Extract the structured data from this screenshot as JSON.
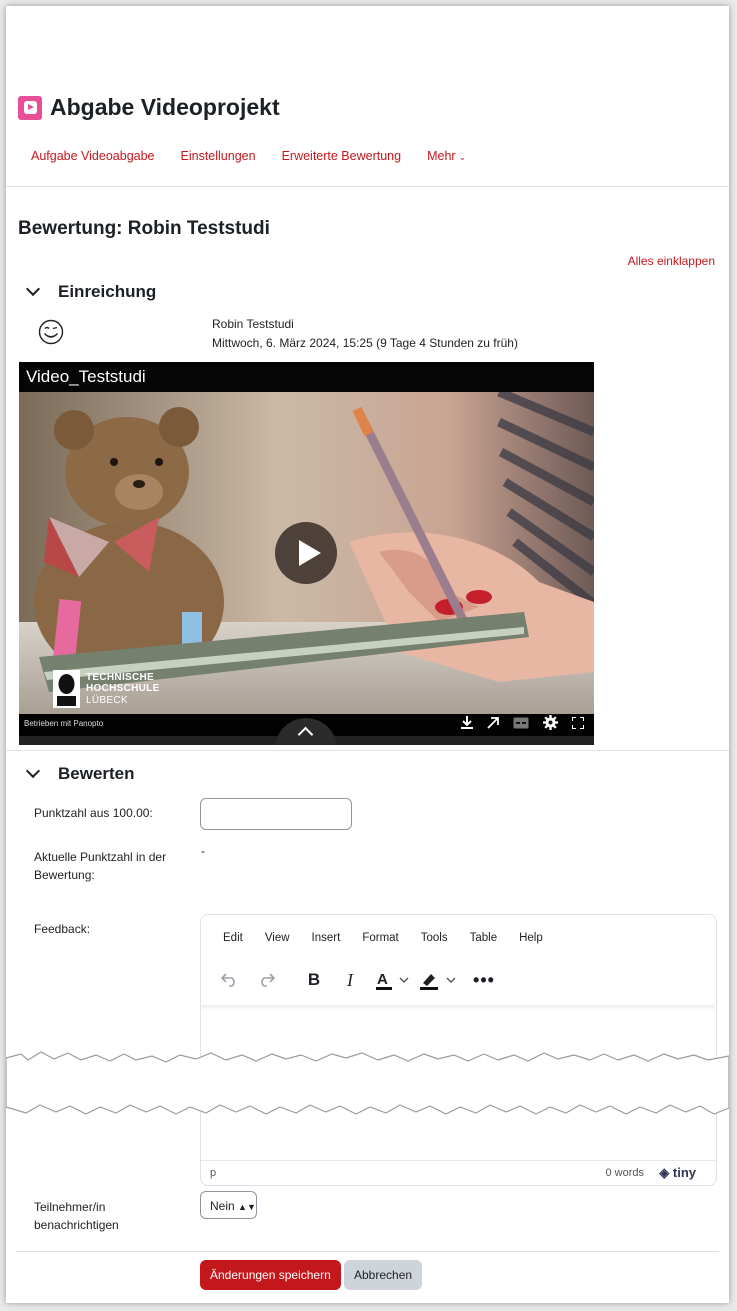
{
  "page": {
    "title": "Abgabe Videoprojekt",
    "nav": [
      "Aufgabe Videoabgabe",
      "Einstellungen",
      "Erweiterte Bewertung",
      "Mehr"
    ],
    "heading": "Bewertung: Robin Teststudi",
    "collapse_all": "Alles einklappen"
  },
  "submission": {
    "section_title": "Einreichung",
    "student_name": "Robin Teststudi",
    "submitted_at": "Mittwoch, 6. März 2024, 15:25 (9 Tage 4 Stunden zu früh)"
  },
  "video": {
    "title": "Video_Teststudi",
    "logo_lines": [
      "TECHNISCHE",
      "HOCHSCHULE",
      "LÜBECK"
    ],
    "powered_by": "Betrieben mit Panopto"
  },
  "grading": {
    "section_title": "Bewerten",
    "grade_label": "Punktzahl aus 100.00:",
    "grade_value": "",
    "current_grade_label": "Aktuelle Punktzahl in der Bewertung:",
    "current_grade_value": "-",
    "feedback_label": "Feedback:",
    "editor_menu": [
      "Edit",
      "View",
      "Insert",
      "Format",
      "Tools",
      "Table",
      "Help"
    ],
    "editor_path": "p",
    "editor_wordcount": "0 words",
    "editor_brand": "tiny",
    "notify_label": "Teilnehmer/in benachrichtigen",
    "notify_value": "Nein"
  },
  "buttons": {
    "save": "Änderungen speichern",
    "cancel": "Abbrechen"
  },
  "colors": {
    "accent": "#c4171c",
    "module_icon": "#e94f97"
  }
}
